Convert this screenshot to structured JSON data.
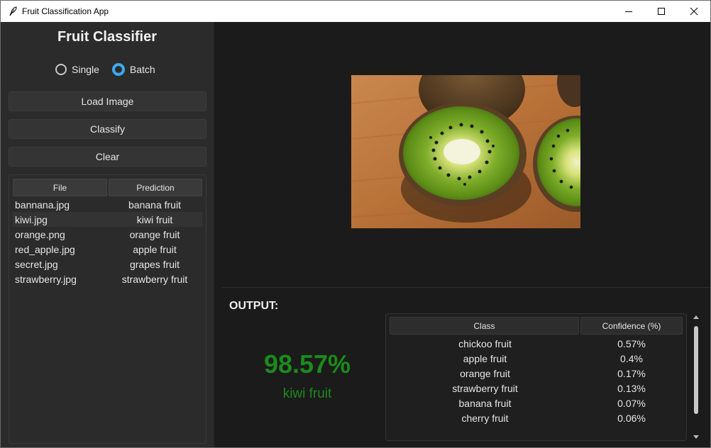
{
  "window": {
    "title": "Fruit Classification App",
    "controls": [
      "minimize",
      "maximize",
      "close"
    ]
  },
  "sidebar": {
    "title": "Fruit Classifier",
    "mode": {
      "options": [
        {
          "label": "Single",
          "selected": false
        },
        {
          "label": "Batch",
          "selected": true
        }
      ]
    },
    "buttons": {
      "load": "Load Image",
      "classify": "Classify",
      "clear": "Clear"
    },
    "files_table": {
      "columns": [
        "File",
        "Prediction"
      ],
      "rows": [
        {
          "file": "bannana.jpg",
          "prediction": "banana fruit"
        },
        {
          "file": "kiwi.jpg",
          "prediction": "kiwi fruit",
          "selected": true
        },
        {
          "file": "orange.png",
          "prediction": "orange fruit"
        },
        {
          "file": "red_apple.jpg",
          "prediction": "apple fruit"
        },
        {
          "file": "secret.jpg",
          "prediction": "grapes fruit"
        },
        {
          "file": "strawberry.jpg",
          "prediction": "strawberry fruit"
        }
      ]
    }
  },
  "main": {
    "image_preview": "kiwi-photo",
    "output": {
      "label": "OUTPUT:",
      "confidence": "98.57%",
      "predicted_class": "kiwi fruit",
      "accent_color": "#1c8a1c"
    },
    "class_table": {
      "columns": [
        "Class",
        "Confidence (%)"
      ],
      "rows": [
        {
          "cls": "chickoo fruit",
          "conf": "0.57%"
        },
        {
          "cls": "apple fruit",
          "conf": "0.4%"
        },
        {
          "cls": "orange fruit",
          "conf": "0.17%"
        },
        {
          "cls": "strawberry fruit",
          "conf": "0.13%"
        },
        {
          "cls": "banana fruit",
          "conf": "0.07%"
        },
        {
          "cls": "cherry fruit",
          "conf": "0.06%"
        }
      ]
    }
  },
  "colors": {
    "radio_selected": "#3ea9f0",
    "background": "#1b1b1b",
    "sidebar": "#2b2b2b"
  }
}
